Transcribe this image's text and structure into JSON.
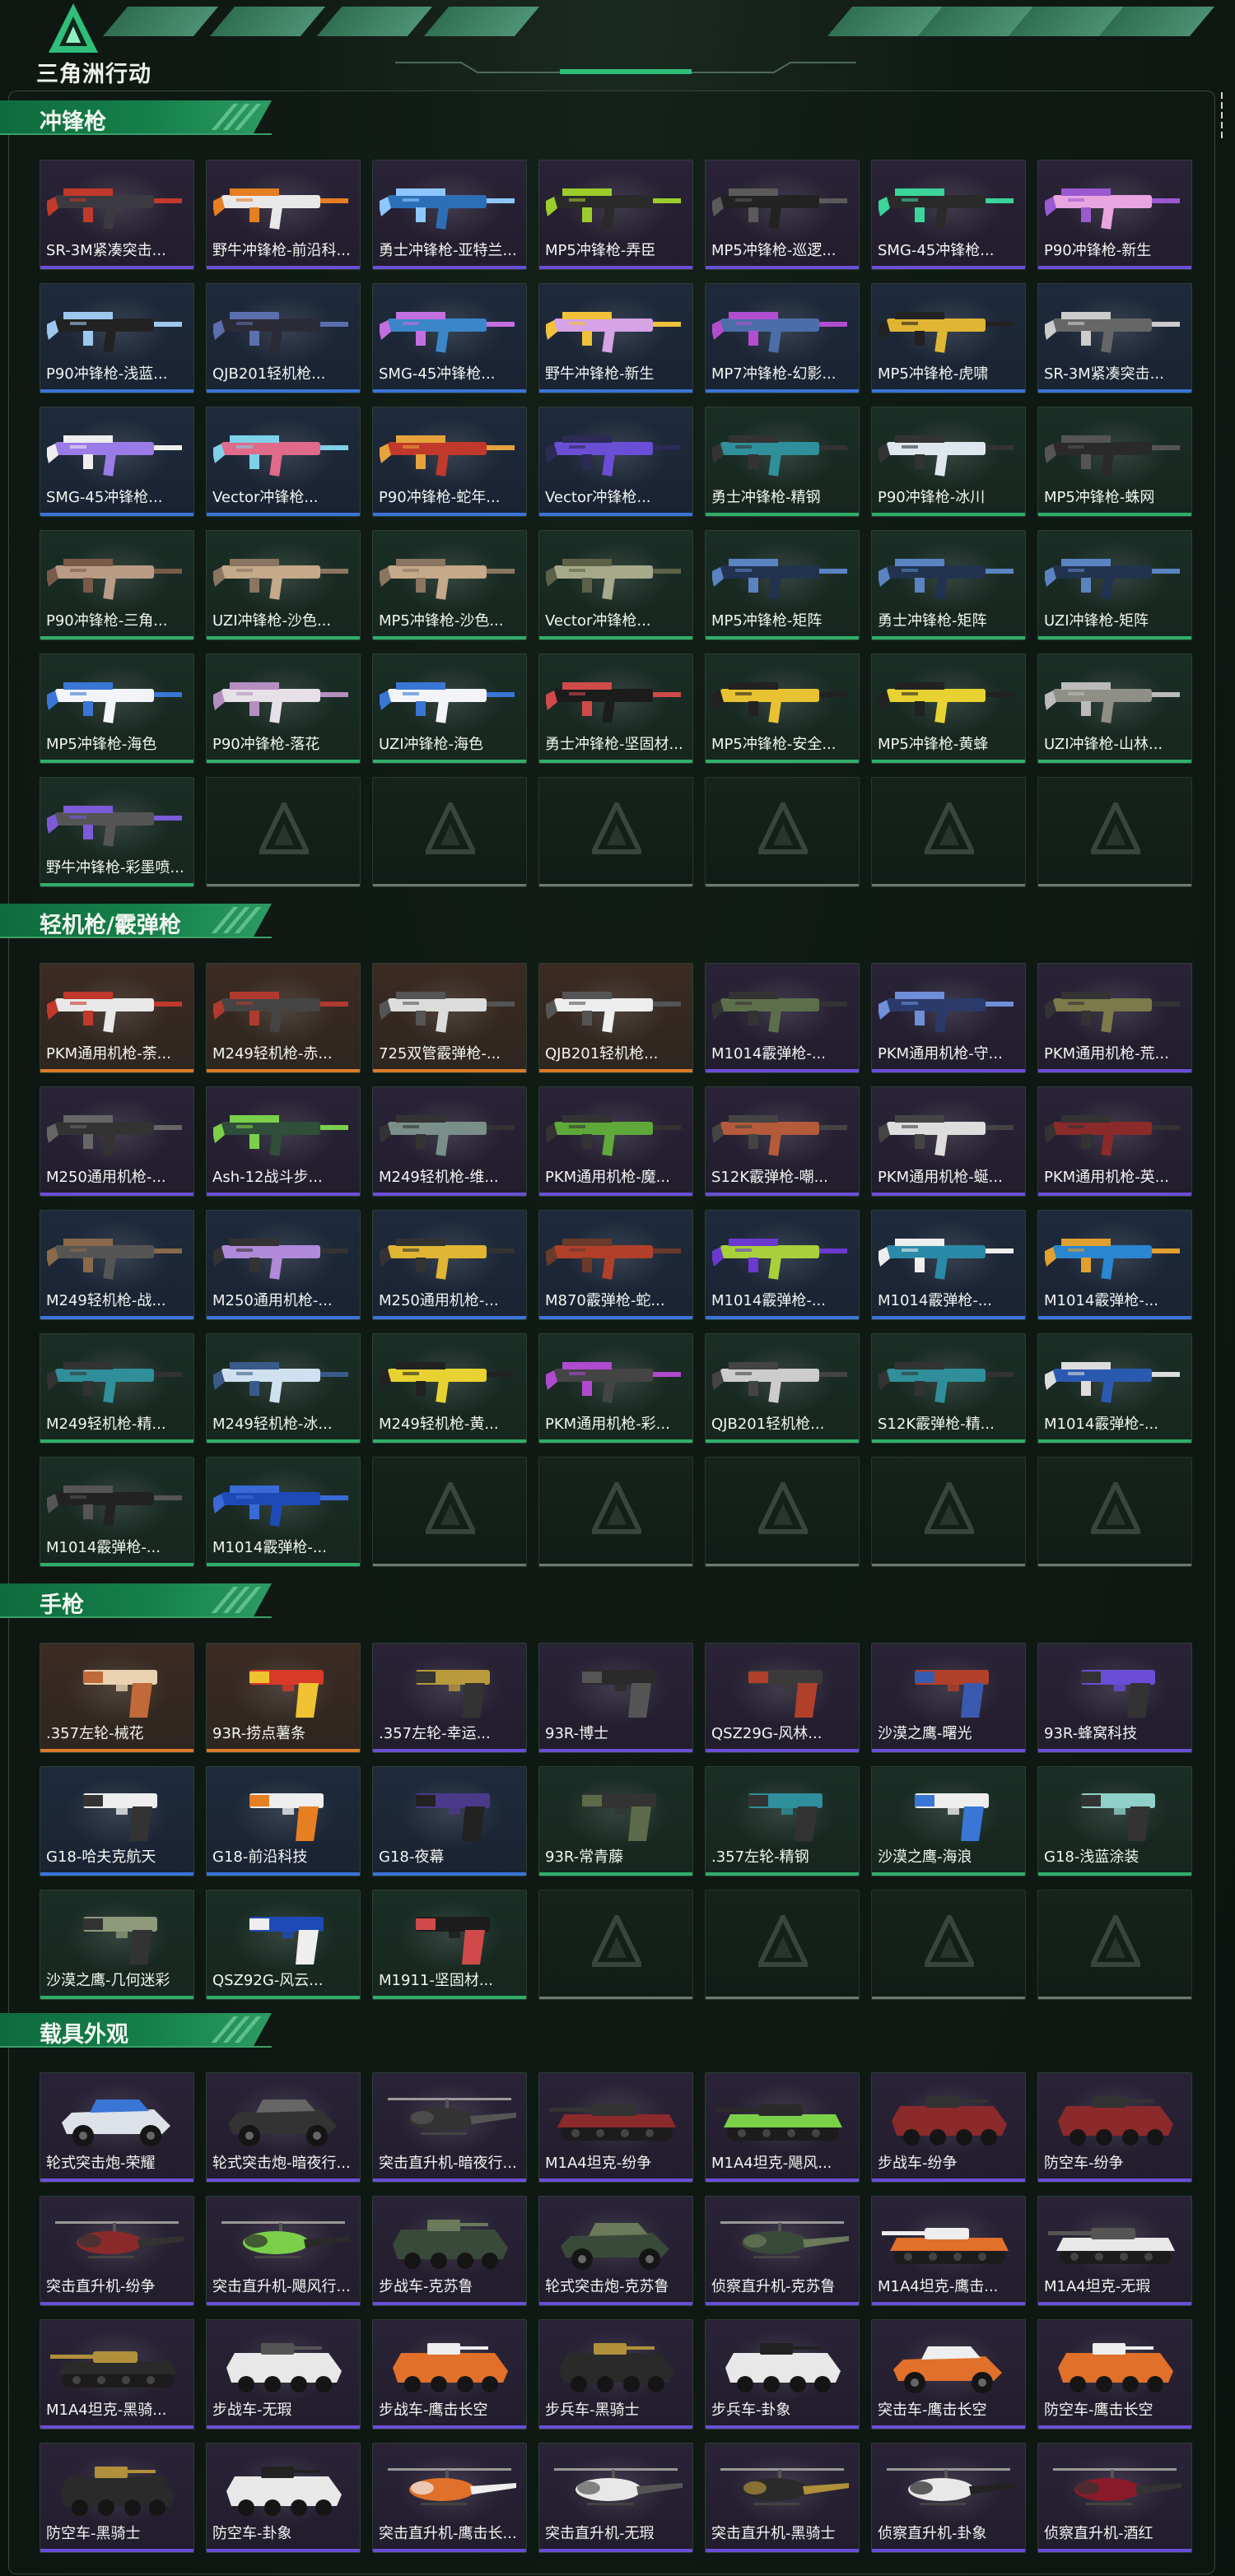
{
  "header": {
    "logo_text": "三角洲行动"
  },
  "colors": {
    "accent": "#15804a",
    "rarity_gold": "#d97a2a",
    "rarity_purple": "#6a4ed6",
    "rarity_blue": "#3b73d9",
    "rarity_green": "#2fae6a"
  },
  "sections": [
    {
      "title": "冲锋枪",
      "items": [
        {
          "label": "SR-3M紧凑突击...",
          "rarity": "purple",
          "kind": "gun",
          "c1": "#3a3a40",
          "c2": "#c0392b"
        },
        {
          "label": "野牛冲锋枪-前沿科...",
          "rarity": "purple",
          "kind": "gun",
          "c1": "#e8e8e8",
          "c2": "#e67e22"
        },
        {
          "label": "勇士冲锋枪-亚特兰...",
          "rarity": "purple",
          "kind": "gun",
          "c1": "#2d6fb6",
          "c2": "#8ec6ff"
        },
        {
          "label": "MP5冲锋枪-弄臣",
          "rarity": "purple",
          "kind": "gun",
          "c1": "#2a2a2a",
          "c2": "#9ccc2b"
        },
        {
          "label": "MP5冲锋枪-巡逻...",
          "rarity": "purple",
          "kind": "gun",
          "c1": "#222",
          "c2": "#5a5a5a"
        },
        {
          "label": "SMG-45冲锋枪...",
          "rarity": "purple",
          "kind": "gun",
          "c1": "#2a2a2a",
          "c2": "#3bd49a"
        },
        {
          "label": "P90冲锋枪-新生",
          "rarity": "purple",
          "kind": "gun",
          "c1": "#e8a5e0",
          "c2": "#9b59d0"
        },
        {
          "label": "P90冲锋枪-浅蓝...",
          "rarity": "blue",
          "kind": "gun",
          "c1": "#222",
          "c2": "#9ec7ee"
        },
        {
          "label": "QJB201轻机枪...",
          "rarity": "blue",
          "kind": "gun",
          "c1": "#2b2b38",
          "c2": "#5b6fae"
        },
        {
          "label": "SMG-45冲锋枪...",
          "rarity": "blue",
          "kind": "gun",
          "c1": "#3a86c9",
          "c2": "#c46fe0"
        },
        {
          "label": "野牛冲锋枪-新生",
          "rarity": "blue",
          "kind": "gun",
          "c1": "#d5a3e6",
          "c2": "#f0c23b"
        },
        {
          "label": "MP7冲锋枪-幻影...",
          "rarity": "blue",
          "kind": "gun",
          "c1": "#4b6ea8",
          "c2": "#b14ed0"
        },
        {
          "label": "MP5冲锋枪-虎啸",
          "rarity": "blue",
          "kind": "gun",
          "c1": "#e0b534",
          "c2": "#222"
        },
        {
          "label": "SR-3M紧凑突击...",
          "rarity": "blue",
          "kind": "gun",
          "c1": "#666",
          "c2": "#ccc"
        },
        {
          "label": "SMG-45冲锋枪...",
          "rarity": "blue",
          "kind": "gun",
          "c1": "#9a7be8",
          "c2": "#eee"
        },
        {
          "label": "Vector冲锋枪...",
          "rarity": "blue",
          "kind": "gun",
          "c1": "#e06a8a",
          "c2": "#7fd0e8"
        },
        {
          "label": "P90冲锋枪-蛇年...",
          "rarity": "blue",
          "kind": "gun",
          "c1": "#c0392b",
          "c2": "#e6a23c"
        },
        {
          "label": "Vector冲锋枪...",
          "rarity": "blue",
          "kind": "gun",
          "c1": "#6a4ed6",
          "c2": "#2b2b55"
        },
        {
          "label": "勇士冲锋枪-精钢",
          "rarity": "green",
          "kind": "gun",
          "c1": "#2f8f9a",
          "c2": "#333"
        },
        {
          "label": "P90冲锋枪-冰川",
          "rarity": "green",
          "kind": "gun",
          "c1": "#dfe7ee",
          "c2": "#333"
        },
        {
          "label": "MP5冲锋枪-蛛网",
          "rarity": "green",
          "kind": "gun",
          "c1": "#2a2a2a",
          "c2": "#555"
        },
        {
          "label": "P90冲锋枪-三角...",
          "rarity": "green",
          "kind": "gun",
          "c1": "#b89c86",
          "c2": "#7a5b4a"
        },
        {
          "label": "UZI冲锋枪-沙色...",
          "rarity": "green",
          "kind": "gun",
          "c1": "#c4a98a",
          "c2": "#8a7560"
        },
        {
          "label": "MP5冲锋枪-沙色...",
          "rarity": "green",
          "kind": "gun",
          "c1": "#c4a98a",
          "c2": "#8a7560"
        },
        {
          "label": "Vector冲锋枪...",
          "rarity": "green",
          "kind": "gun",
          "c1": "#a7aa8a",
          "c2": "#5c6148"
        },
        {
          "label": "MP5冲锋枪-矩阵",
          "rarity": "green",
          "kind": "gun",
          "c1": "#22334f",
          "c2": "#5b83c2"
        },
        {
          "label": "勇士冲锋枪-矩阵",
          "rarity": "green",
          "kind": "gun",
          "c1": "#22334f",
          "c2": "#5b83c2"
        },
        {
          "label": "UZI冲锋枪-矩阵",
          "rarity": "green",
          "kind": "gun",
          "c1": "#22334f",
          "c2": "#5b83c2"
        },
        {
          "label": "MP5冲锋枪-海色",
          "rarity": "green",
          "kind": "gun",
          "c1": "#f2f4f8",
          "c2": "#3a76d6"
        },
        {
          "label": "P90冲锋枪-落花",
          "rarity": "green",
          "kind": "gun",
          "c1": "#e6e0e8",
          "c2": "#b58fc0"
        },
        {
          "label": "UZI冲锋枪-海色",
          "rarity": "green",
          "kind": "gun",
          "c1": "#f2f4f8",
          "c2": "#3a76d6"
        },
        {
          "label": "勇士冲锋枪-坚固材...",
          "rarity": "green",
          "kind": "gun",
          "c1": "#1c1c1c",
          "c2": "#d04a4a"
        },
        {
          "label": "MP5冲锋枪-安全...",
          "rarity": "green",
          "kind": "gun",
          "c1": "#e8c232",
          "c2": "#222"
        },
        {
          "label": "MP5冲锋枪-黄蜂",
          "rarity": "green",
          "kind": "gun",
          "c1": "#e8d232",
          "c2": "#222"
        },
        {
          "label": "UZI冲锋枪-山林...",
          "rarity": "green",
          "kind": "gun",
          "c1": "#8f8f86",
          "c2": "#bbb"
        },
        {
          "label": "野牛冲锋枪-彩墨喷...",
          "rarity": "green",
          "kind": "gun",
          "c1": "#555",
          "c2": "#7c5ad8"
        }
      ],
      "empty_slots": 6
    },
    {
      "title": "轻机枪/霰弹枪",
      "items": [
        {
          "label": "PKM通用机枪-荼...",
          "rarity": "gold",
          "kind": "gun",
          "c1": "#e8e8e8",
          "c2": "#c0392b"
        },
        {
          "label": "M249轻机枪-赤...",
          "rarity": "gold",
          "kind": "gun",
          "c1": "#444",
          "c2": "#b03a2e"
        },
        {
          "label": "725双管霰弹枪-...",
          "rarity": "gold",
          "kind": "gun",
          "c1": "#dcdcdc",
          "c2": "#555"
        },
        {
          "label": "QJB201轻机枪...",
          "rarity": "gold",
          "kind": "gun",
          "c1": "#eee",
          "c2": "#555"
        },
        {
          "label": "M1014霰弹枪-...",
          "rarity": "purple",
          "kind": "gun",
          "c1": "#5d6f4a",
          "c2": "#333"
        },
        {
          "label": "PKM通用机枪-守...",
          "rarity": "purple",
          "kind": "gun",
          "c1": "#2a3a6a",
          "c2": "#6f8fd8"
        },
        {
          "label": "PKM通用机枪-荒...",
          "rarity": "purple",
          "kind": "gun",
          "c1": "#7b7a4a",
          "c2": "#333"
        },
        {
          "label": "M250通用机枪-...",
          "rarity": "purple",
          "kind": "gun",
          "c1": "#333",
          "c2": "#666"
        },
        {
          "label": "Ash-12战斗步...",
          "rarity": "purple",
          "kind": "gun",
          "c1": "#2f4f3a",
          "c2": "#7bd04a"
        },
        {
          "label": "M249轻机枪-维...",
          "rarity": "purple",
          "kind": "gun",
          "c1": "#7a8e8a",
          "c2": "#333"
        },
        {
          "label": "PKM通用机枪-魔...",
          "rarity": "purple",
          "kind": "gun",
          "c1": "#5fa83a",
          "c2": "#333"
        },
        {
          "label": "S12K霰弹枪-嘲...",
          "rarity": "purple",
          "kind": "gun",
          "c1": "#b55a3a",
          "c2": "#444"
        },
        {
          "label": "PKM通用机枪-蜒...",
          "rarity": "purple",
          "kind": "gun",
          "c1": "#ddd",
          "c2": "#444"
        },
        {
          "label": "PKM通用机枪-英...",
          "rarity": "purple",
          "kind": "gun",
          "c1": "#8a2a2a",
          "c2": "#333"
        },
        {
          "label": "M249轻机枪-战...",
          "rarity": "blue",
          "kind": "gun",
          "c1": "#555",
          "c2": "#8a6a4a"
        },
        {
          "label": "M250通用机枪-...",
          "rarity": "blue",
          "kind": "gun",
          "c1": "#b08ad8",
          "c2": "#333"
        },
        {
          "label": "M250通用机枪-...",
          "rarity": "blue",
          "kind": "gun",
          "c1": "#e0b534",
          "c2": "#333"
        },
        {
          "label": "M870霰弹枪-蛇...",
          "rarity": "blue",
          "kind": "gun",
          "c1": "#b0402a",
          "c2": "#6a3a2a"
        },
        {
          "label": "M1014霰弹枪-...",
          "rarity": "blue",
          "kind": "gun",
          "c1": "#a8d03a",
          "c2": "#6a3ad0"
        },
        {
          "label": "M1014霰弹枪-...",
          "rarity": "blue",
          "kind": "gun",
          "c1": "#2a8aa8",
          "c2": "#eee"
        },
        {
          "label": "M1014霰弹枪-...",
          "rarity": "blue",
          "kind": "gun",
          "c1": "#2a86d0",
          "c2": "#e0a030"
        },
        {
          "label": "M249轻机枪-精...",
          "rarity": "green",
          "kind": "gun",
          "c1": "#2f8f9a",
          "c2": "#333"
        },
        {
          "label": "M249轻机枪-冰...",
          "rarity": "green",
          "kind": "gun",
          "c1": "#cfe0ee",
          "c2": "#3a5a8a"
        },
        {
          "label": "M249轻机枪-黄...",
          "rarity": "green",
          "kind": "gun",
          "c1": "#e8d232",
          "c2": "#222"
        },
        {
          "label": "PKM通用机枪-彩...",
          "rarity": "green",
          "kind": "gun",
          "c1": "#444",
          "c2": "#b04ad0"
        },
        {
          "label": "QJB201轻机枪...",
          "rarity": "green",
          "kind": "gun",
          "c1": "#ccc",
          "c2": "#444"
        },
        {
          "label": "S12K霰弹枪-精...",
          "rarity": "green",
          "kind": "gun",
          "c1": "#2f8f9a",
          "c2": "#333"
        },
        {
          "label": "M1014霰弹枪-...",
          "rarity": "green",
          "kind": "gun",
          "c1": "#2a5ab0",
          "c2": "#ddd"
        },
        {
          "label": "M1014霰弹枪-...",
          "rarity": "green",
          "kind": "gun",
          "c1": "#222",
          "c2": "#555"
        },
        {
          "label": "M1014霰弹枪-...",
          "rarity": "green",
          "kind": "gun",
          "c1": "#1e4ab8",
          "c2": "#3a6ad8"
        }
      ],
      "empty_slots": 5
    },
    {
      "title": "手枪",
      "items": [
        {
          "label": ".357左轮-械花",
          "rarity": "gold",
          "kind": "pistol",
          "c1": "#e8d2b0",
          "c2": "#c06a3a"
        },
        {
          "label": "93R-捞点薯条",
          "rarity": "gold",
          "kind": "pistol",
          "c1": "#d83a2a",
          "c2": "#f0c232"
        },
        {
          "label": ".357左轮-幸运...",
          "rarity": "purple",
          "kind": "pistol",
          "c1": "#b89a3a",
          "c2": "#333"
        },
        {
          "label": "93R-博士",
          "rarity": "purple",
          "kind": "pistol",
          "c1": "#2a2a2a",
          "c2": "#555"
        },
        {
          "label": "QSZ29G-风林...",
          "rarity": "purple",
          "kind": "pistol",
          "c1": "#3a3a3a",
          "c2": "#b0402a"
        },
        {
          "label": "沙漠之鹰-曙光",
          "rarity": "purple",
          "kind": "pistol",
          "c1": "#b0402a",
          "c2": "#3a5ab0"
        },
        {
          "label": "93R-蜂窝科技",
          "rarity": "purple",
          "kind": "pistol",
          "c1": "#6a4ed6",
          "c2": "#333"
        },
        {
          "label": "G18-哈夫克航天",
          "rarity": "blue",
          "kind": "pistol",
          "c1": "#eee",
          "c2": "#333"
        },
        {
          "label": "G18-前沿科技",
          "rarity": "blue",
          "kind": "pistol",
          "c1": "#eee",
          "c2": "#e67e22"
        },
        {
          "label": "G18-夜幕",
          "rarity": "blue",
          "kind": "pistol",
          "c1": "#4a3a8a",
          "c2": "#222"
        },
        {
          "label": "93R-常青藤",
          "rarity": "green",
          "kind": "pistol",
          "c1": "#333",
          "c2": "#5a6a4a"
        },
        {
          "label": ".357左轮-精钢",
          "rarity": "green",
          "kind": "pistol",
          "c1": "#2f8f9a",
          "c2": "#333"
        },
        {
          "label": "沙漠之鹰-海浪",
          "rarity": "green",
          "kind": "pistol",
          "c1": "#eee",
          "c2": "#3a76d6"
        },
        {
          "label": "G18-浅蓝涂装",
          "rarity": "green",
          "kind": "pistol",
          "c1": "#8fd0c8",
          "c2": "#333"
        },
        {
          "label": "沙漠之鹰-几何迷彩",
          "rarity": "green",
          "kind": "pistol",
          "c1": "#8f9a7a",
          "c2": "#333"
        },
        {
          "label": "QSZ92G-风云...",
          "rarity": "green",
          "kind": "pistol",
          "c1": "#1e4ab8",
          "c2": "#eee"
        },
        {
          "label": "M1911-坚固材...",
          "rarity": "green",
          "kind": "pistol",
          "c1": "#1c1c1c",
          "c2": "#d04a4a"
        }
      ],
      "empty_slots": 4
    },
    {
      "title": "载具外观",
      "items": [
        {
          "label": "轮式突击炮-荣耀",
          "rarity": "purple",
          "kind": "buggy",
          "c1": "#dde2e8",
          "c2": "#3a76d6"
        },
        {
          "label": "轮式突击炮-暗夜行...",
          "rarity": "purple",
          "kind": "buggy",
          "c1": "#333",
          "c2": "#666"
        },
        {
          "label": "突击直升机-暗夜行...",
          "rarity": "purple",
          "kind": "heli",
          "c1": "#333",
          "c2": "#555"
        },
        {
          "label": "M1A4坦克-纷争",
          "rarity": "purple",
          "kind": "tank",
          "c1": "#8a2a2a",
          "c2": "#333"
        },
        {
          "label": "M1A4坦克-飓风...",
          "rarity": "purple",
          "kind": "tank",
          "c1": "#7bd04a",
          "c2": "#2a2a2a"
        },
        {
          "label": "步战车-纷争",
          "rarity": "purple",
          "kind": "apc",
          "c1": "#8a2a2a",
          "c2": "#333"
        },
        {
          "label": "防空车-纷争",
          "rarity": "purple",
          "kind": "apc",
          "c1": "#8a2a2a",
          "c2": "#333"
        },
        {
          "label": "突击直升机-纷争",
          "rarity": "purple",
          "kind": "heli",
          "c1": "#8a2a2a",
          "c2": "#333"
        },
        {
          "label": "突击直升机-飓风行...",
          "rarity": "purple",
          "kind": "heli",
          "c1": "#7bd04a",
          "c2": "#2a2a2a"
        },
        {
          "label": "步战车-克苏鲁",
          "rarity": "purple",
          "kind": "apc",
          "c1": "#3a4a3a",
          "c2": "#6a7a5a"
        },
        {
          "label": "轮式突击炮-克苏鲁",
          "rarity": "purple",
          "kind": "buggy",
          "c1": "#3a4a3a",
          "c2": "#6a7a5a"
        },
        {
          "label": "侦察直升机-克苏鲁",
          "rarity": "purple",
          "kind": "heli",
          "c1": "#3a4a3a",
          "c2": "#6a7a5a"
        },
        {
          "label": "M1A4坦克-鹰击...",
          "rarity": "purple",
          "kind": "tank",
          "c1": "#e0702a",
          "c2": "#eee"
        },
        {
          "label": "M1A4坦克-无瑕",
          "rarity": "purple",
          "kind": "tank",
          "c1": "#e8e8e8",
          "c2": "#555"
        },
        {
          "label": "M1A4坦克-黑骑...",
          "rarity": "purple",
          "kind": "tank",
          "c1": "#2a2a2a",
          "c2": "#b0903a"
        },
        {
          "label": "步战车-无瑕",
          "rarity": "purple",
          "kind": "apc",
          "c1": "#e8e8e8",
          "c2": "#555"
        },
        {
          "label": "步战车-鹰击长空",
          "rarity": "purple",
          "kind": "apc",
          "c1": "#e0702a",
          "c2": "#eee"
        },
        {
          "label": "步兵车-黑骑士",
          "rarity": "purple",
          "kind": "apc",
          "c1": "#2a2a2a",
          "c2": "#b0903a"
        },
        {
          "label": "步兵车-卦象",
          "rarity": "purple",
          "kind": "apc",
          "c1": "#e8e8e8",
          "c2": "#222"
        },
        {
          "label": "突击车-鹰击长空",
          "rarity": "purple",
          "kind": "buggy",
          "c1": "#e0702a",
          "c2": "#eee"
        },
        {
          "label": "防空车-鹰击长空",
          "rarity": "purple",
          "kind": "apc",
          "c1": "#e0702a",
          "c2": "#eee"
        },
        {
          "label": "防空车-黑骑士",
          "rarity": "purple",
          "kind": "apc",
          "c1": "#2a2a2a",
          "c2": "#b0903a"
        },
        {
          "label": "防空车-卦象",
          "rarity": "purple",
          "kind": "apc",
          "c1": "#e8e8e8",
          "c2": "#222"
        },
        {
          "label": "突击直升机-鹰击长...",
          "rarity": "purple",
          "kind": "heli",
          "c1": "#e0702a",
          "c2": "#eee"
        },
        {
          "label": "突击直升机-无瑕",
          "rarity": "purple",
          "kind": "heli",
          "c1": "#e8e8e8",
          "c2": "#555"
        },
        {
          "label": "突击直升机-黑骑士",
          "rarity": "purple",
          "kind": "heli",
          "c1": "#2a2a2a",
          "c2": "#b0903a"
        },
        {
          "label": "侦察直升机-卦象",
          "rarity": "purple",
          "kind": "heli",
          "c1": "#e8e8e8",
          "c2": "#222"
        },
        {
          "label": "侦察直升机-酒红",
          "rarity": "purple",
          "kind": "heli",
          "c1": "#8a1a2a",
          "c2": "#333"
        }
      ],
      "empty_slots": 0
    }
  ]
}
